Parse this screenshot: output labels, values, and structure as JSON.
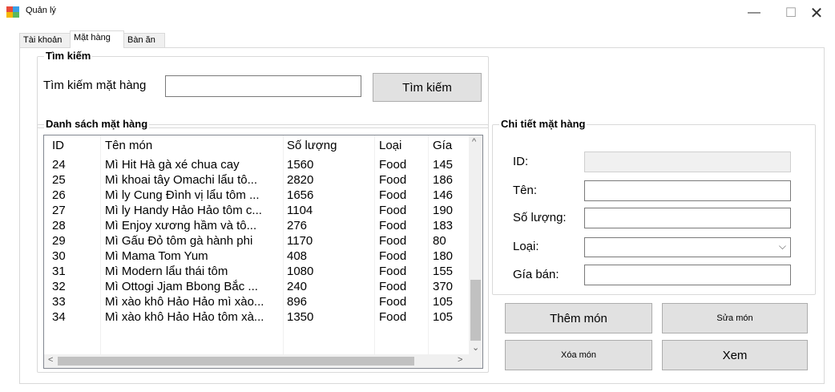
{
  "window": {
    "title": "Quản lý",
    "minimize": "—",
    "maximize": "☐",
    "close": "✕"
  },
  "tabs": [
    {
      "label": "Tài khoản",
      "active": false
    },
    {
      "label": "Mặt hàng",
      "active": true
    },
    {
      "label": "Bàn ăn",
      "active": false
    }
  ],
  "search": {
    "group_title": "Tìm kiếm",
    "label": "Tìm kiếm mặt hàng",
    "value": "",
    "button": "Tìm kiếm"
  },
  "list": {
    "group_title": "Danh sách mặt hàng",
    "columns": [
      "ID",
      "Tên món",
      "Số lượng",
      "Loại",
      "Gía"
    ],
    "rows": [
      [
        "24",
        "Mì Hit Hà gà xé chua cay",
        "1560",
        "Food",
        "145"
      ],
      [
        "25",
        "Mì khoai tây Omachi lẩu tô...",
        "2820",
        "Food",
        "186"
      ],
      [
        "26",
        "Mì ly Cung Đình vị lẩu tôm ...",
        "1656",
        "Food",
        "146"
      ],
      [
        "27",
        "Mì ly Handy Hảo Hảo tôm c...",
        "1104",
        "Food",
        "190"
      ],
      [
        "28",
        "Mì Enjoy xương hầm và tô...",
        "276",
        "Food",
        "183"
      ],
      [
        "29",
        "Mì Gấu Đỏ tôm gà hành phi",
        "1170",
        "Food",
        "80"
      ],
      [
        "30",
        "Mì Mama Tom Yum",
        "408",
        "Food",
        "180"
      ],
      [
        "31",
        "Mì Modern lẩu thái tôm",
        "1080",
        "Food",
        "155"
      ],
      [
        "32",
        "Mì Ottogi Jjam Bbong Bắc ...",
        "240",
        "Food",
        "370"
      ],
      [
        "33",
        "Mì xào khô Hảo Hảo mì xào...",
        "896",
        "Food",
        "105"
      ],
      [
        "34",
        "Mì xào khô Hảo Hảo tôm xà...",
        "1350",
        "Food",
        "105"
      ]
    ]
  },
  "detail": {
    "group_title": "Chi tiết mặt hàng",
    "id_label": "ID:",
    "id_value": "",
    "name_label": "Tên:",
    "name_value": "",
    "qty_label": "Số lượng:",
    "qty_value": "",
    "type_label": "Loại:",
    "type_value": "",
    "price_label": "Gía bán:",
    "price_value": ""
  },
  "actions": {
    "add": "Thêm món",
    "edit": "Sửa món",
    "delete": "Xóa món",
    "view": "Xem"
  }
}
